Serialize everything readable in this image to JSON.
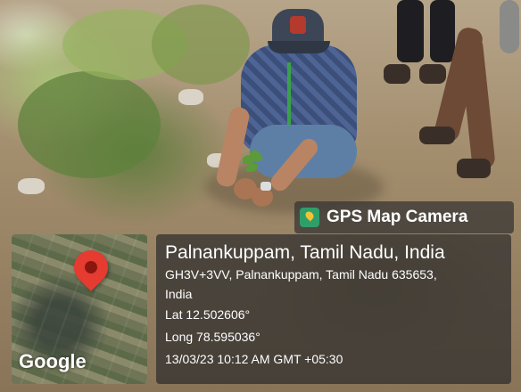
{
  "watermark": {
    "app_name": "GPS Map Camera",
    "icon": "map-pin-icon"
  },
  "location": {
    "title": "Palnankuppam, Tamil Nadu, India",
    "address_line1": "GH3V+3VV, Palnankuppam, Tamil Nadu 635653,",
    "address_line2": "India",
    "lat": "Lat 12.502606°",
    "long": "Long 78.595036°",
    "timestamp": "13/03/23 10:12 AM GMT +05:30"
  },
  "map": {
    "provider": "Google",
    "marker_icon": "location-marker-icon"
  }
}
